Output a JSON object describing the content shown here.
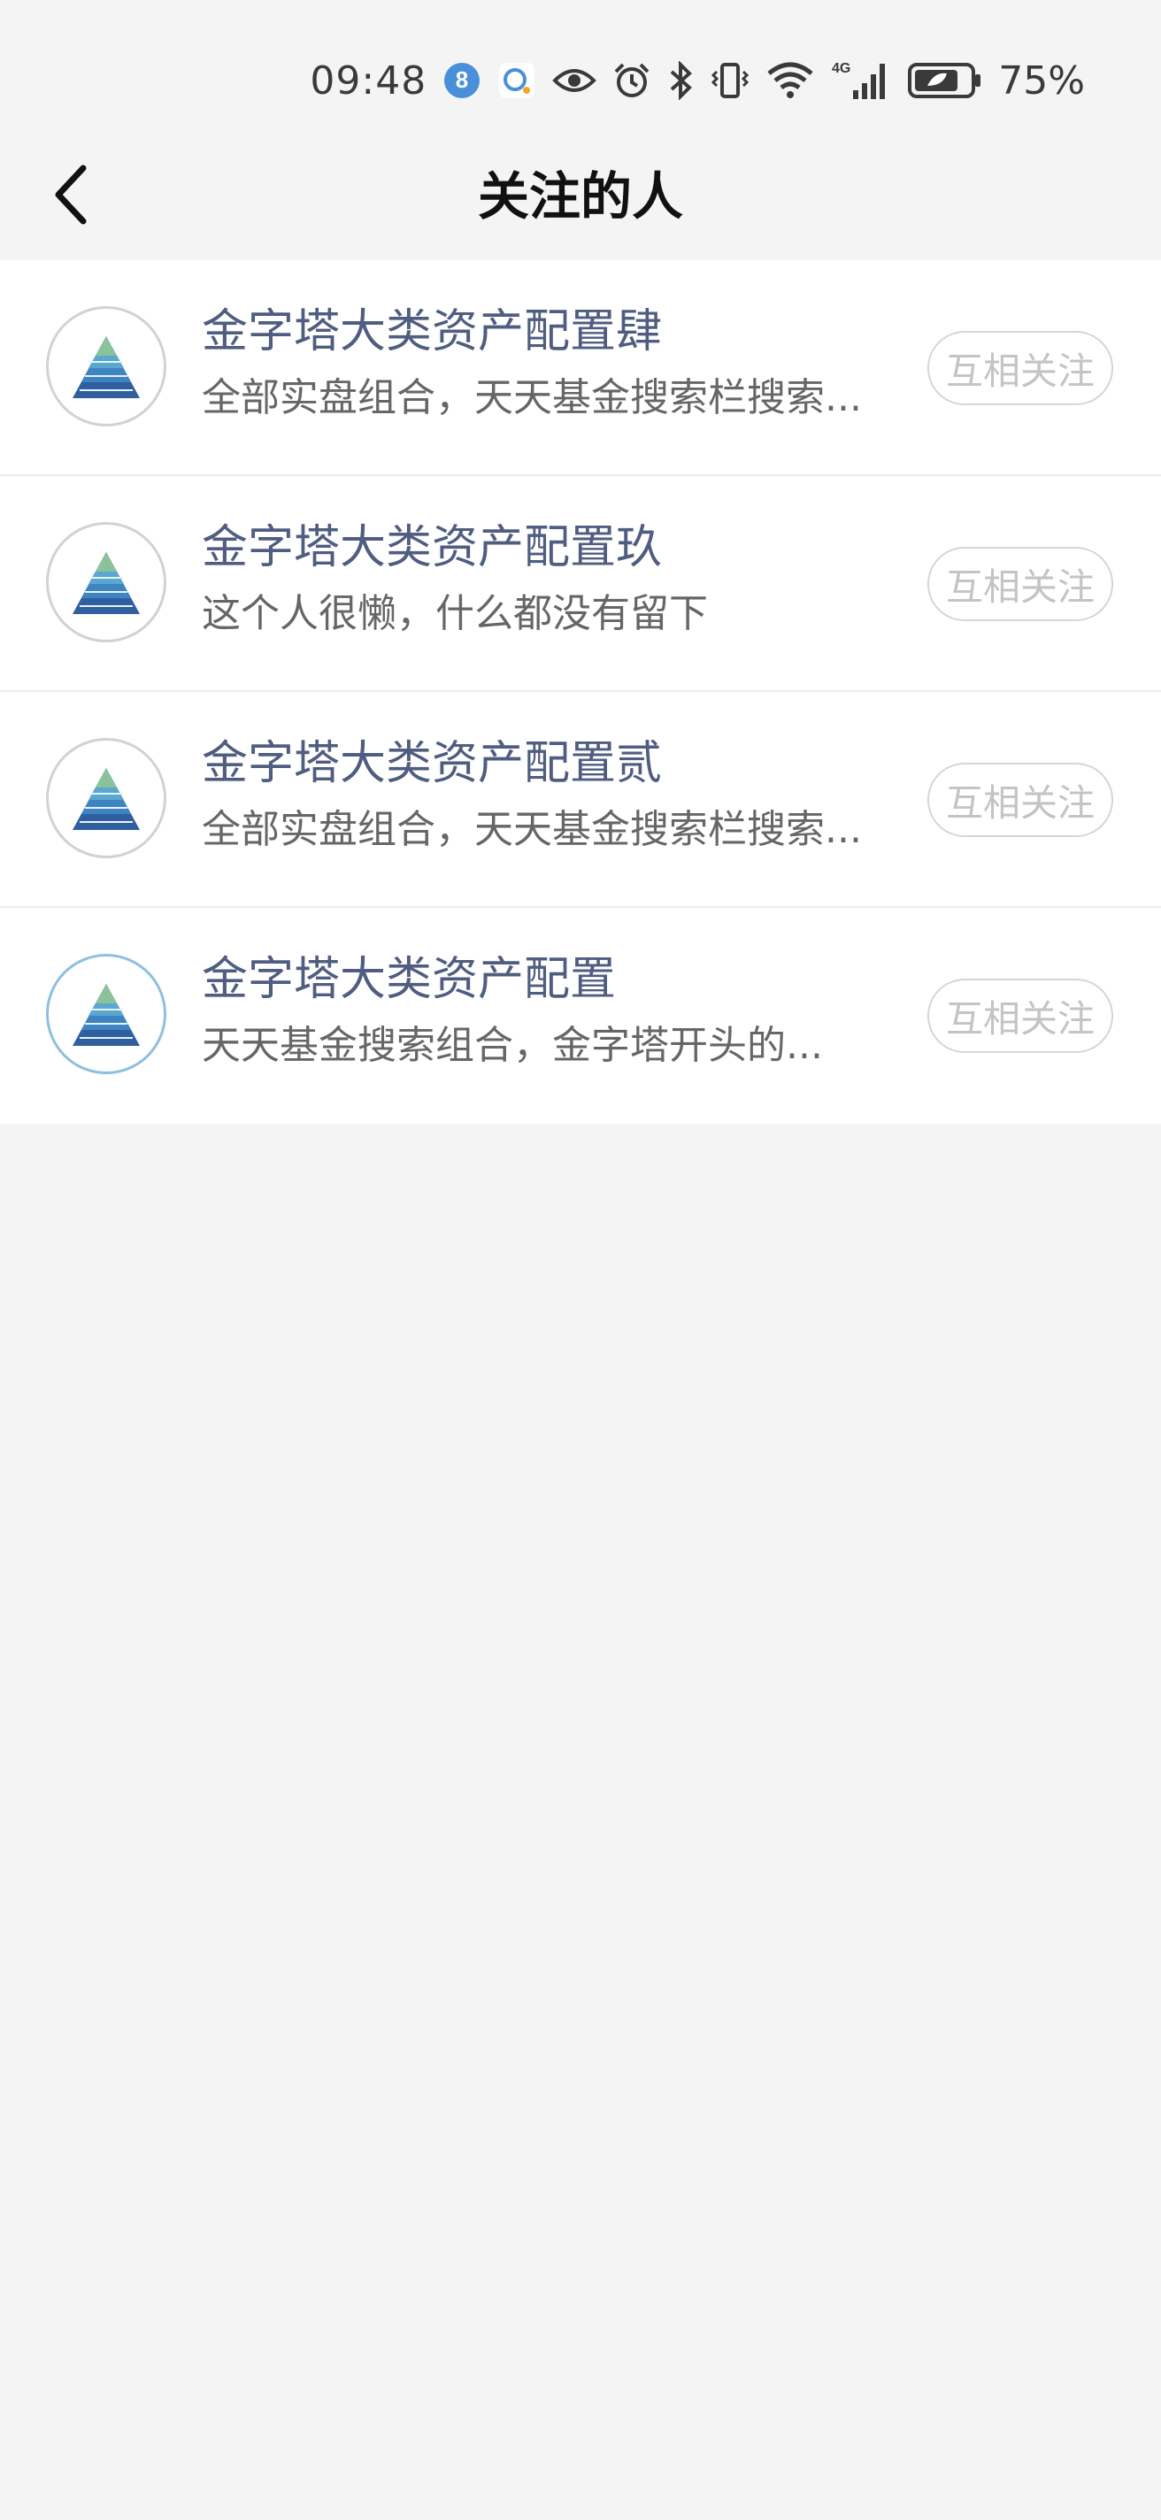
{
  "status_bar": {
    "time": "09:48",
    "badge_number": "8",
    "network": "4G",
    "battery_percent": "75%",
    "icons": [
      "notification-badge-icon",
      "chat-icon",
      "eye-icon",
      "alarm-icon",
      "bluetooth-icon",
      "vibrate-icon",
      "wifi-icon",
      "cellular-signal-icon",
      "battery-icon"
    ]
  },
  "header": {
    "title": "关注的人",
    "back_icon": "chevron-left-icon"
  },
  "follow_list": [
    {
      "name": "金字塔大类资产配置肆",
      "description": "全部实盘组合，天天基金搜索栏搜索...",
      "button_label": "互相关注",
      "avatar_icon": "pyramid-avatar-icon"
    },
    {
      "name": "金字塔大类资产配置玖",
      "description": "这个人很懒，什么都没有留下",
      "button_label": "互相关注",
      "avatar_icon": "pyramid-avatar-icon"
    },
    {
      "name": "金字塔大类资产配置贰",
      "description": "全部实盘组合，天天基金搜索栏搜索...",
      "button_label": "互相关注",
      "avatar_icon": "pyramid-avatar-icon"
    },
    {
      "name": "金字塔大类资产配置",
      "description": "天天基金搜索组合，金字塔开头的...",
      "button_label": "互相关注",
      "avatar_icon": "pyramid-avatar-icon"
    }
  ],
  "colors": {
    "background": "#f4f4f5",
    "name_text": "#4f5d80",
    "description_text": "#666666",
    "button_text": "#c4c4c4",
    "pyramid_top": "#8cc29a",
    "pyramid_bottom": "#2f5f9e"
  }
}
